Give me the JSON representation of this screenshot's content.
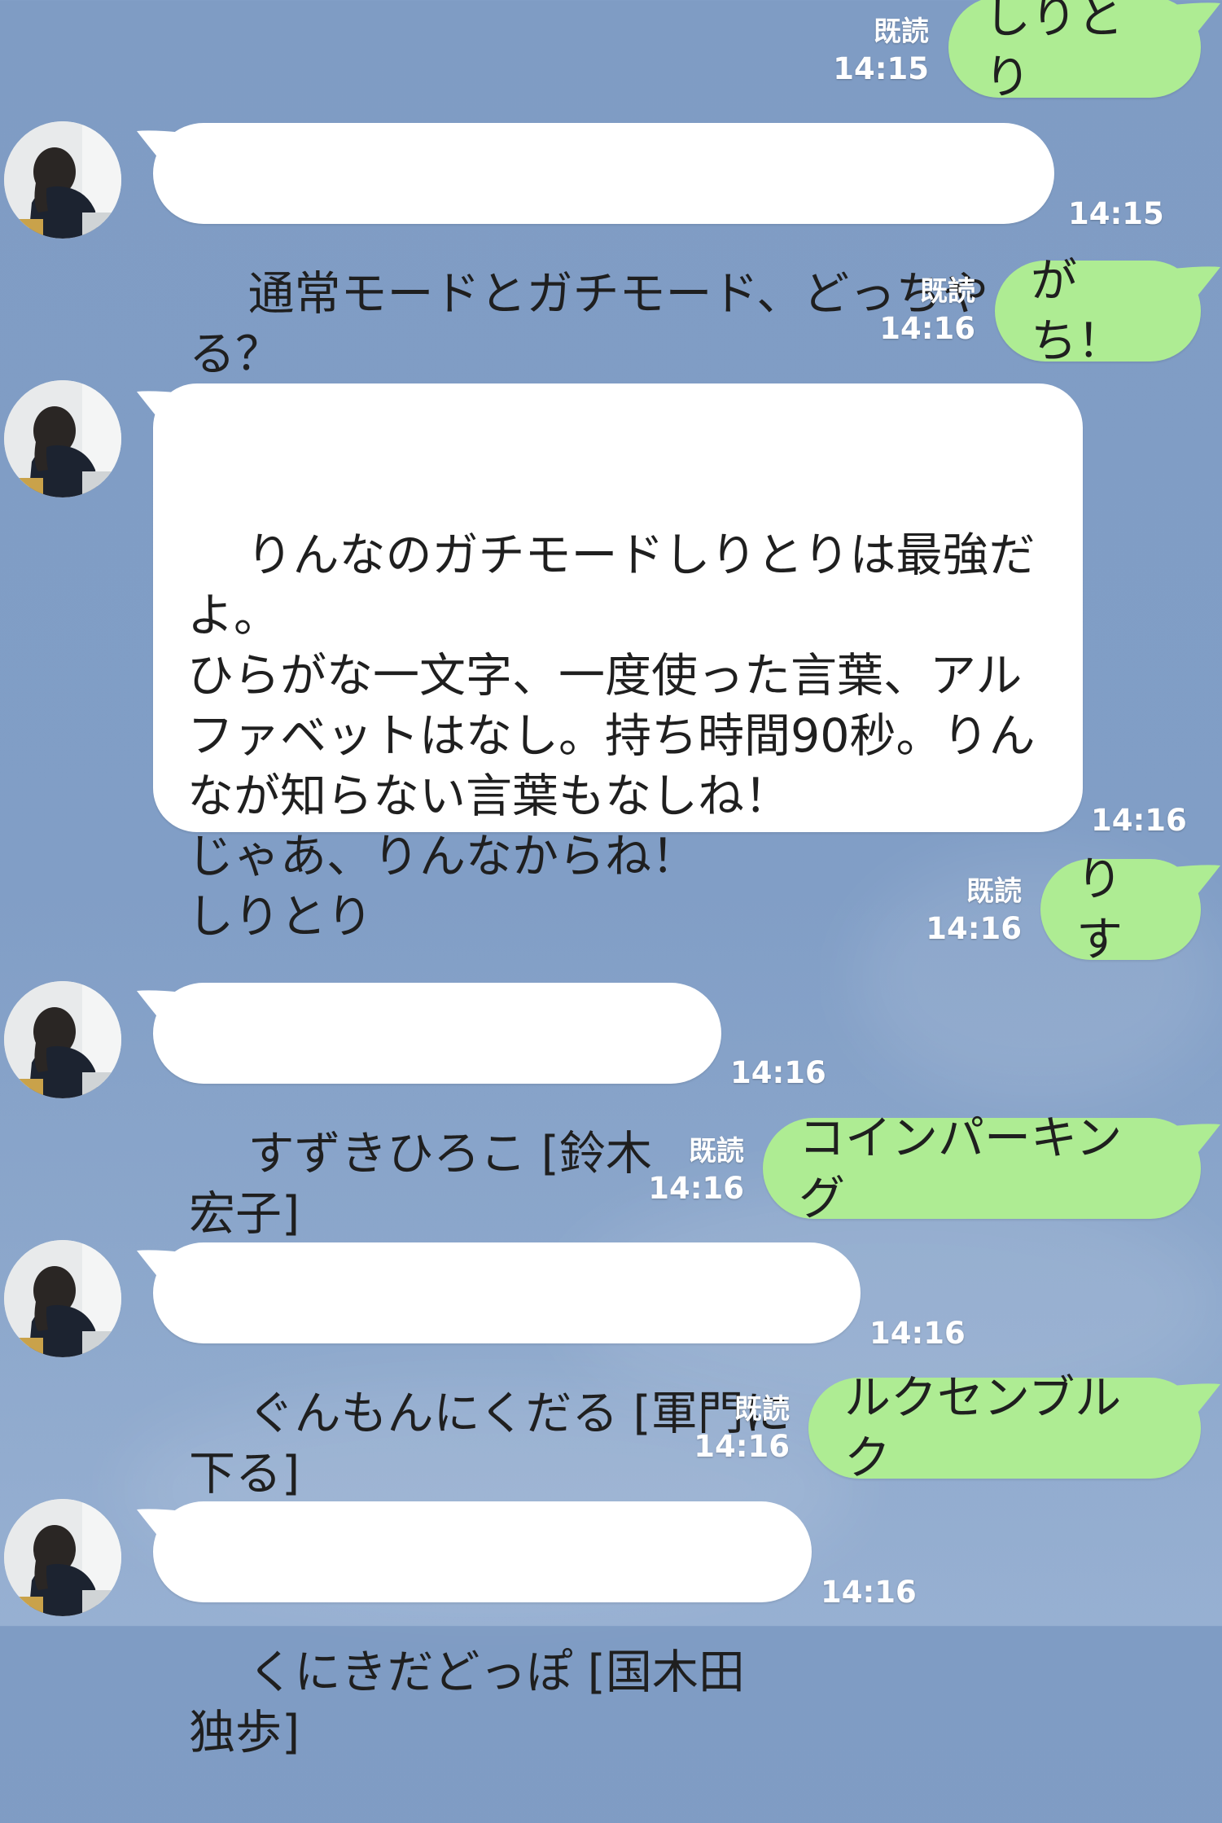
{
  "chat": {
    "messages": [
      {
        "side": "out",
        "text": "しりとり",
        "read": "既読",
        "time": "14:15"
      },
      {
        "side": "in",
        "text": "通常モードとガチモード、どっちやる？",
        "time": "14:15"
      },
      {
        "side": "out",
        "text": "がち！",
        "read": "既読",
        "time": "14:16"
      },
      {
        "side": "in",
        "text": "りんなのガチモードしりとりは最強だ\nよ。\nひらがな一文字、一度使った言葉、アル\nファベットはなし。持ち時間90秒。りん\nなが知らない言葉もなしね！\nじゃあ、りんなからね！\nしりとり",
        "time": "14:16"
      },
      {
        "side": "out",
        "text": "りす",
        "read": "既読",
        "time": "14:16"
      },
      {
        "side": "in",
        "text": "すずきひろこ [鈴木宏子]",
        "time": "14:16"
      },
      {
        "side": "out",
        "text": "コインパーキング",
        "read": "既読",
        "time": "14:16"
      },
      {
        "side": "in",
        "text": "ぐんもんにくだる [軍門に下る]",
        "time": "14:16"
      },
      {
        "side": "out",
        "text": "ルクセンブルク",
        "read": "既読",
        "time": "14:16"
      },
      {
        "side": "in",
        "text": "くにきだどっぽ [国木田独歩]",
        "time": "14:16"
      }
    ]
  },
  "colors": {
    "background": "#819ec6",
    "outgoing_bubble": "#aeec93",
    "incoming_bubble": "#ffffff"
  }
}
